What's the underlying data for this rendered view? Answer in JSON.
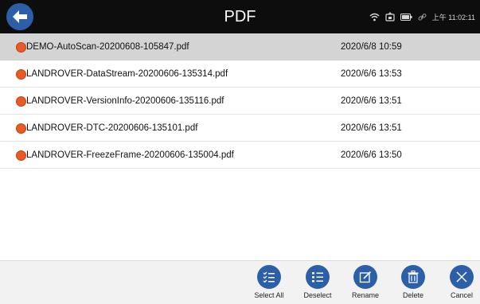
{
  "header": {
    "title": "PDF",
    "back_icon": "back-arrow-icon",
    "status": {
      "icons": [
        "wifi-icon",
        "vci-icon",
        "battery-icon",
        "link-icon"
      ],
      "time": "上午 11:02:11"
    }
  },
  "files": [
    {
      "name": "DEMO-AutoScan-20200608-105847.pdf",
      "date": "2020/6/8 10:59",
      "selected": true
    },
    {
      "name": "LANDROVER-DataStream-20200606-135314.pdf",
      "date": "2020/6/6 13:53",
      "selected": false
    },
    {
      "name": "LANDROVER-VersionInfo-20200606-135116.pdf",
      "date": "2020/6/6 13:51",
      "selected": false
    },
    {
      "name": "LANDROVER-DTC-20200606-135101.pdf",
      "date": "2020/6/6 13:51",
      "selected": false
    },
    {
      "name": "LANDROVER-FreezeFrame-20200606-135004.pdf",
      "date": "2020/6/6 13:50",
      "selected": false
    }
  ],
  "toolbar": {
    "select_all": "Select All",
    "deselect": "Deselect",
    "rename": "Rename",
    "delete": "Delete",
    "cancel": "Cancel"
  },
  "colors": {
    "accent": "#2d5fa8",
    "file_dot": "#e85a26",
    "header_bg": "#0d0d0d",
    "selected_row": "#d4d4d4"
  }
}
